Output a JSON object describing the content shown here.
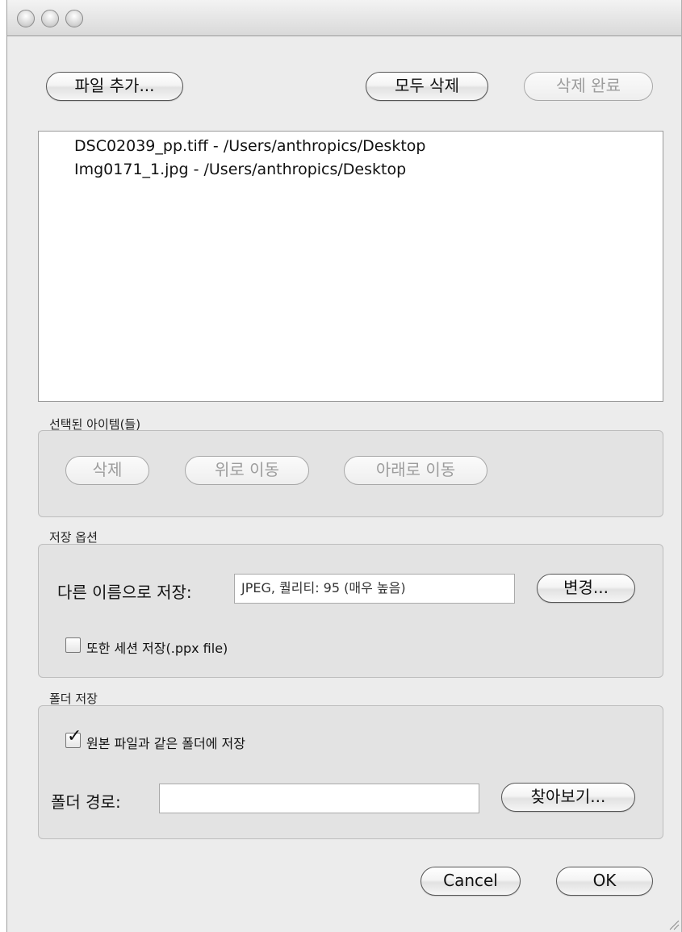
{
  "toolbar": {
    "add_files": "파일 추가...",
    "remove_all": "모두 삭제",
    "remove_finished": "삭제 완료"
  },
  "file_list": [
    {
      "label": "DSC02039_pp.tiff  -  /Users/anthropics/Desktop"
    },
    {
      "label": "Img0171_1.jpg  -  /Users/anthropics/Desktop"
    }
  ],
  "selected_items": {
    "legend": "선택된 아이템(들)",
    "delete": "삭제",
    "move_up": "위로 이동",
    "move_down": "아래로 이동"
  },
  "save_options": {
    "legend": "저장 옵션",
    "save_as_label": "다른 이름으로 저장:",
    "save_as_value": "JPEG, 퀄리티: 95 (매우 높음)",
    "change": "변경...",
    "also_save_session": "또한 세션 저장(.ppx file)",
    "also_save_session_checked": false
  },
  "folder_save": {
    "legend": "폴더 저장",
    "same_folder": "원본 파일과 같은 폴더에 저장",
    "same_folder_checked": true,
    "path_label": "폴더 경로:",
    "path_value": "",
    "browse": "찾아보기..."
  },
  "footer": {
    "cancel": "Cancel",
    "ok": "OK"
  },
  "icons": {
    "check": "checkmark-icon",
    "resize": "resize-grip-icon"
  }
}
